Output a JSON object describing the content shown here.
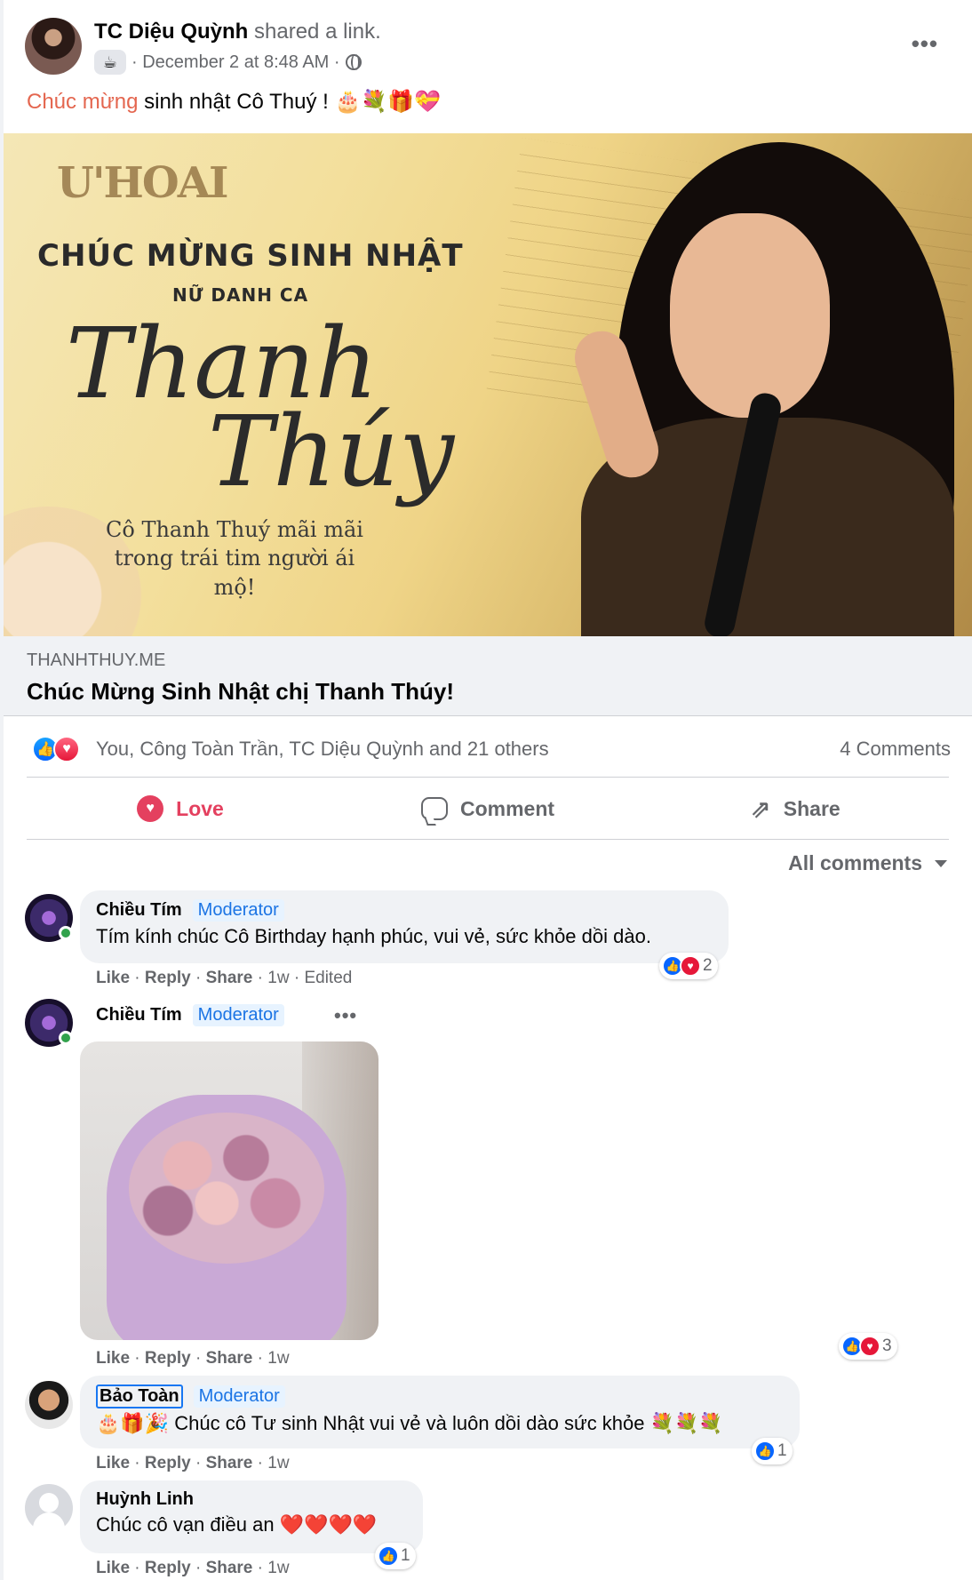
{
  "post": {
    "author_name": "TC Diệu Quỳnh",
    "author_action": "shared a link.",
    "date": "· December 2 at 8:48 AM ·",
    "cup_icon": "☕",
    "more_icon": "•••",
    "text_accent": "Chúc mừng",
    "text_rest": " sinh nhật Cô Thuý ! 🎂💐🎁💝"
  },
  "link": {
    "image_logo": "U'HOAI",
    "image_headline": "CHÚC MỪNG SINH NHẬT",
    "image_subheadline": "NỮ DANH CA",
    "image_signature_1": "Thanh",
    "image_signature_2": "Thúy",
    "image_tribute": "Cô Thanh Thuý mãi mãi trong trái tim người ái mộ!",
    "info_icon": "i",
    "domain": "THANHTHUY.ME",
    "title": "Chúc Mừng Sinh Nhật chị Thanh Thúy!"
  },
  "summary": {
    "reactors": "You, Công Toàn Trần, TC Diệu Quỳnh and 21 others",
    "comment_count": "4 Comments",
    "like_glyph": "👍",
    "love_glyph": "♥"
  },
  "actions": {
    "love": "Love",
    "comment": "Comment",
    "share": "Share",
    "share_glyph": "⇗"
  },
  "filter": {
    "label": "All comments"
  },
  "comments": [
    {
      "name": "Chiều Tím",
      "badge": "Moderator",
      "text": "Tím kính chúc Cô Birthday hạnh phúc, vui vẻ, sức khỏe dồi dào.",
      "like": "Like",
      "reply": "Reply",
      "share": "Share",
      "time": "1w",
      "edited": "Edited",
      "reaction_count": "2"
    },
    {
      "name": "Chiều Tím",
      "badge": "Moderator",
      "like": "Like",
      "reply": "Reply",
      "share": "Share",
      "time": "1w",
      "reaction_count": "3"
    },
    {
      "name": "Bảo Toàn",
      "badge": "Moderator",
      "text": "🎂🎁🎉 Chúc cô Tư sinh Nhật vui vẻ và luôn dồi dào sức khỏe 💐💐💐",
      "like": "Like",
      "reply": "Reply",
      "share": "Share",
      "time": "1w",
      "reaction_count": "1"
    },
    {
      "name": "Huỳnh Linh",
      "text": "Chúc cô vạn điều an ❤️❤️❤️❤️",
      "like": "Like",
      "reply": "Reply",
      "share": "Share",
      "time": "1w",
      "reaction_count": "1"
    }
  ],
  "colors": {
    "accent_orange": "#e4664f",
    "love_red": "#e4405f",
    "like_blue": "#0866ff",
    "moderator_blue": "#1b74e4"
  }
}
